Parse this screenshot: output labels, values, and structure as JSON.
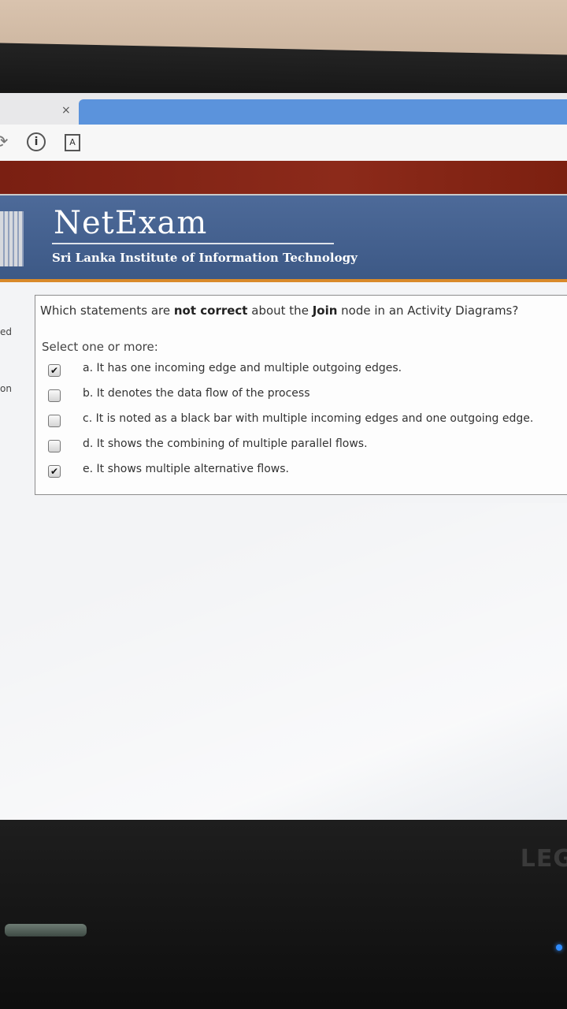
{
  "browser": {
    "close_glyph": "×",
    "info_glyph": "i",
    "pdf_glyph": "A"
  },
  "header": {
    "logo": "NetExam",
    "institute": "Sri Lanka Institute of Information Technology"
  },
  "sidebar": {
    "fragment_1": "ed",
    "fragment_2": "on"
  },
  "question": {
    "text_part1": "Which statements are ",
    "text_bold1": "not correct",
    "text_part2": " about the ",
    "text_bold2": "Join",
    "text_part3": " node in an Activity Diagrams?",
    "prompt": "Select one or more:",
    "options": [
      {
        "label": "a. It has one incoming edge and multiple outgoing edges.",
        "checked": true
      },
      {
        "label": "b. It denotes the data flow of the process",
        "checked": false
      },
      {
        "label": "c. It is noted as a black bar with multiple incoming edges and one outgoing edge.",
        "checked": false
      },
      {
        "label": "d. It shows the combining of multiple parallel flows.",
        "checked": false
      },
      {
        "label": "e. It shows multiple alternative flows.",
        "checked": true
      }
    ]
  },
  "device": {
    "brand": "LEG"
  },
  "colors": {
    "header_blue": "#4d6a99",
    "top_band_red": "#7a1f12",
    "accent_orange": "#d98a2a",
    "tab_blue": "#5b93dc"
  }
}
